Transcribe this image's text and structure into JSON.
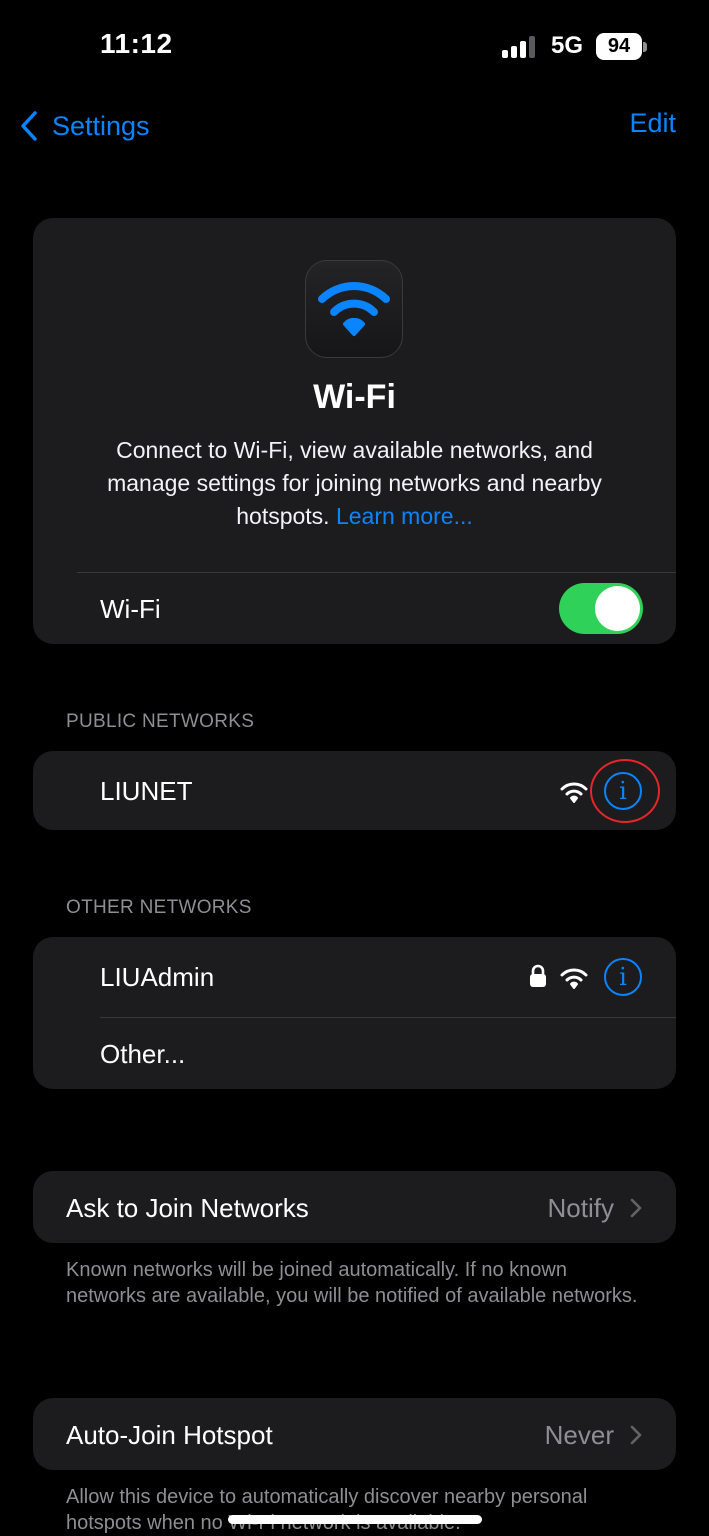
{
  "status_bar": {
    "time": "11:12",
    "network": "5G",
    "battery": "94"
  },
  "nav": {
    "back_label": "Settings",
    "edit_label": "Edit"
  },
  "hero": {
    "title": "Wi-Fi",
    "description": "Connect to Wi-Fi, view available networks, and manage settings for joining networks and nearby hotspots.",
    "learn_more": "Learn more..."
  },
  "wifi_row": {
    "label": "Wi-Fi",
    "enabled": true
  },
  "public_networks": {
    "header": "PUBLIC NETWORKS",
    "items": [
      {
        "name": "LIUNET",
        "secured": false
      }
    ]
  },
  "other_networks": {
    "header": "OTHER NETWORKS",
    "items": [
      {
        "name": "LIUAdmin",
        "secured": true
      }
    ],
    "other_label": "Other..."
  },
  "ask_to_join": {
    "label": "Ask to Join Networks",
    "value": "Notify",
    "footnote": "Known networks will be joined automatically. If no known networks are available, you will be notified of available networks."
  },
  "auto_join_hotspot": {
    "label": "Auto-Join Hotspot",
    "value": "Never",
    "footnote": "Allow this device to automatically discover nearby personal hotspots when no Wi-Fi network is available."
  },
  "colors": {
    "accent": "#0a84ff",
    "toggle_on": "#30d158",
    "highlight": "#e5262a",
    "card": "#1c1c1e"
  }
}
